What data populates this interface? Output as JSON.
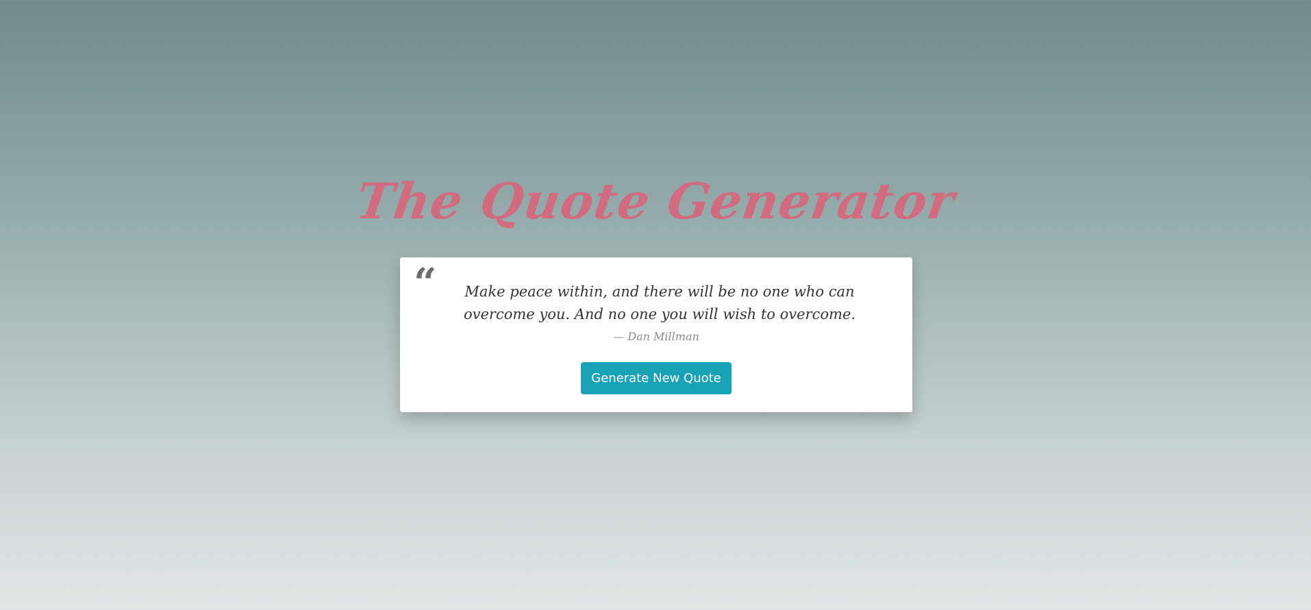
{
  "page": {
    "title": "The Quote Generator"
  },
  "quote": {
    "mark": "“",
    "text": "Make peace within, and there will be no one who can overcome you. And no one you will wish to overcome.",
    "author_prefix": "—",
    "author": "Dan Millman"
  },
  "actions": {
    "generate_label": "Generate New Quote"
  },
  "colors": {
    "title": "#d16b80",
    "button": "#17a2b8",
    "card": "#ffffff"
  }
}
